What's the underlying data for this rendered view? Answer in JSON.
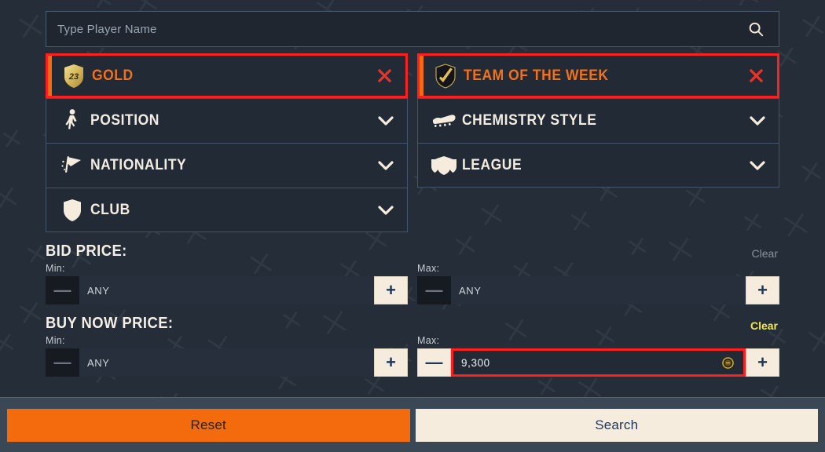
{
  "search": {
    "placeholder": "Type Player Name",
    "value": "",
    "icon": "search-icon"
  },
  "filters": {
    "left": [
      {
        "label": "GOLD",
        "icon": "gold-shield-23-icon",
        "selected": true,
        "action": "x-icon",
        "badge": "23"
      },
      {
        "label": "POSITION",
        "icon": "player-figure-icon",
        "selected": false,
        "action": "chevron-down-icon",
        "badge": ""
      },
      {
        "label": "NATIONALITY",
        "icon": "flag-icon",
        "selected": false,
        "action": "chevron-down-icon",
        "badge": ""
      },
      {
        "label": "CLUB",
        "icon": "club-shield-icon",
        "selected": false,
        "action": "chevron-down-icon",
        "badge": ""
      }
    ],
    "right": [
      {
        "label": "TEAM OF THE WEEK",
        "icon": "totw-shield-icon",
        "selected": true,
        "action": "x-icon",
        "badge": ""
      },
      {
        "label": "CHEMISTRY STYLE",
        "icon": "boot-icon",
        "selected": false,
        "action": "chevron-down-icon",
        "badge": ""
      },
      {
        "label": "LEAGUE",
        "icon": "league-shields-icon",
        "selected": false,
        "action": "chevron-down-icon",
        "badge": ""
      }
    ]
  },
  "bid_price": {
    "heading": "BID PRICE:",
    "clear_label": "Clear",
    "clear_active": false,
    "min": {
      "label": "Min:",
      "value": "ANY",
      "minus_enabled": false,
      "plus_enabled": true,
      "highlighted": false,
      "has_coin": false
    },
    "max": {
      "label": "Max:",
      "value": "ANY",
      "minus_enabled": false,
      "plus_enabled": true,
      "highlighted": false,
      "has_coin": false
    }
  },
  "buy_now_price": {
    "heading": "BUY NOW PRICE:",
    "clear_label": "Clear",
    "clear_active": true,
    "min": {
      "label": "Min:",
      "value": "ANY",
      "minus_enabled": false,
      "plus_enabled": true,
      "highlighted": false,
      "has_coin": false
    },
    "max": {
      "label": "Max:",
      "value": "9,300",
      "minus_enabled": true,
      "plus_enabled": true,
      "highlighted": true,
      "has_coin": true
    }
  },
  "footer": {
    "reset_label": "Reset",
    "search_label": "Search"
  },
  "stepper_glyphs": {
    "plus": "+",
    "minus": "—"
  },
  "colors": {
    "accent_orange": "#f36b0d",
    "highlight_red": "#ff1f1f",
    "clear_active_yellow": "#f2e849",
    "cream": "#f5ecdd",
    "navy_text": "#1d3557",
    "panel_bg": "#222a35",
    "page_bg": "#242d38",
    "footer_bg": "#3a4754",
    "border_blue": "#44546a",
    "gold": "#d9bb5c"
  }
}
